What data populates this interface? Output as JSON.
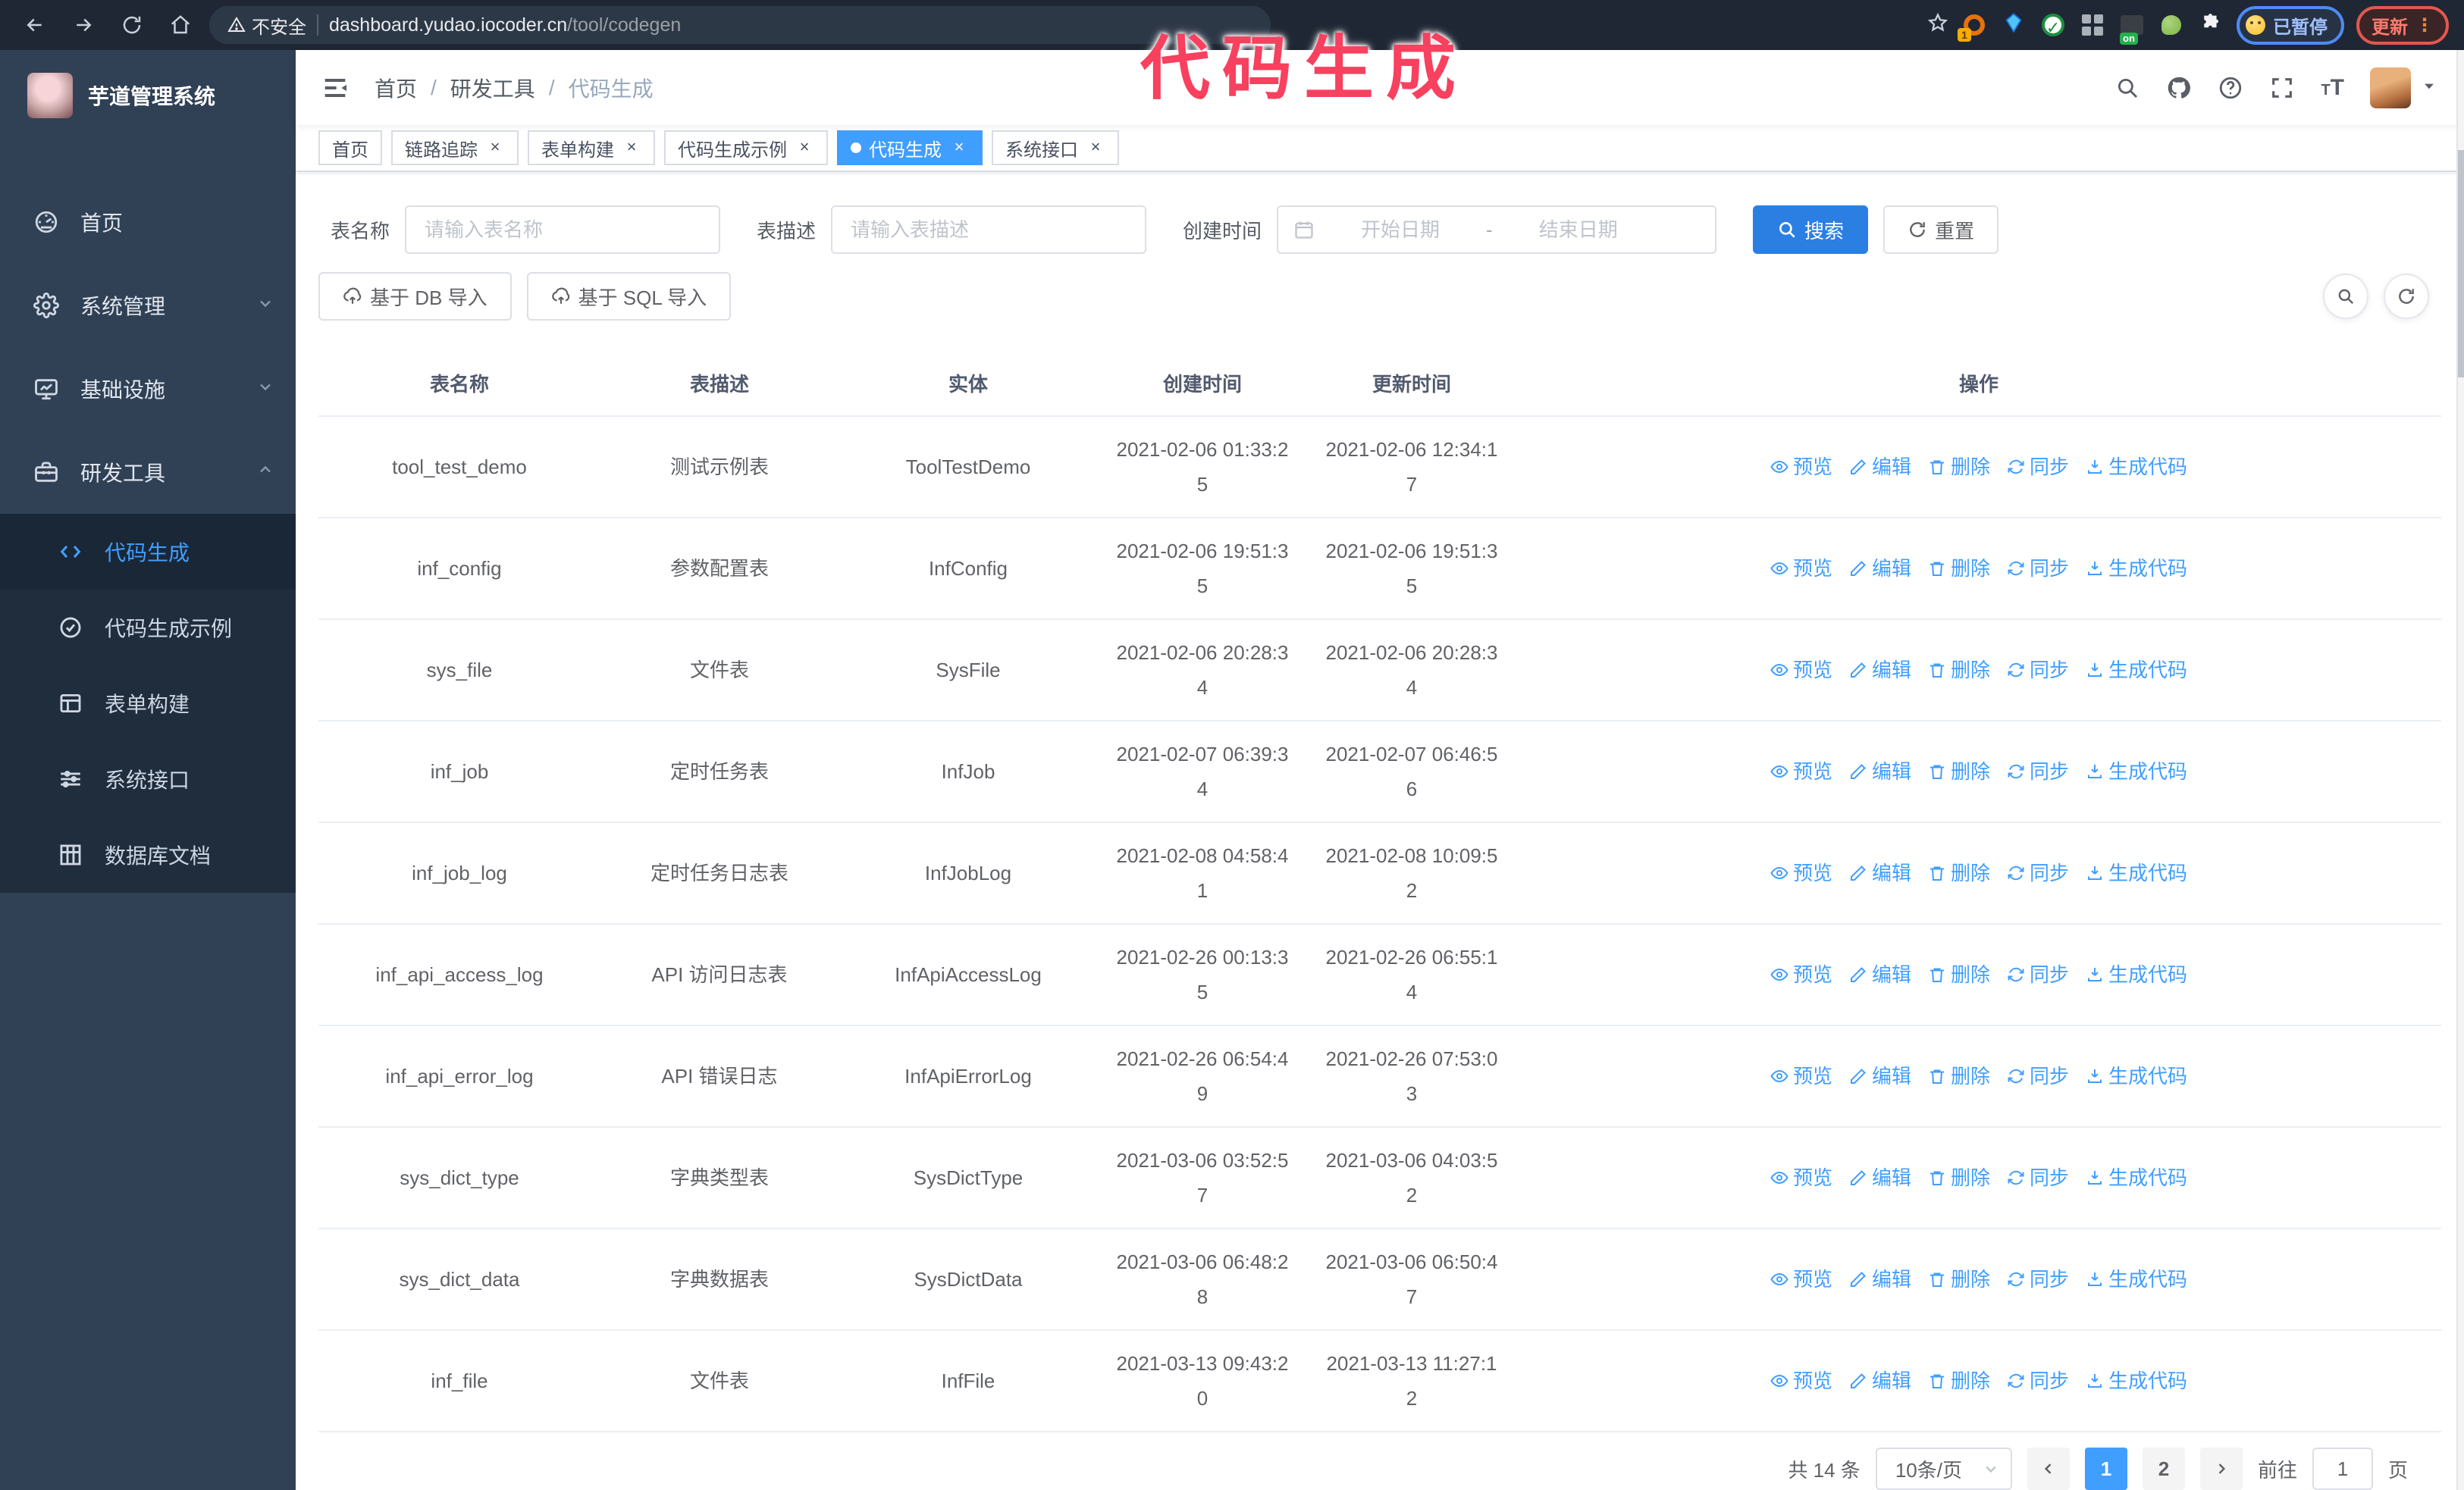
{
  "colors": {
    "accent": "#409eff",
    "sidebar_bg": "#304156",
    "submenu_bg": "#1f2d3d",
    "annotation": "#f8405f",
    "tag_active_bg": "#409eff"
  },
  "annotation": {
    "text": "代码生成"
  },
  "browser": {
    "nav_icons": [
      "back-icon",
      "forward-icon",
      "reload-icon",
      "home-icon"
    ],
    "security_label": "不安全",
    "url_domain": "dashboard.yudao.iocoder.cn",
    "url_path": "/tool/codegen",
    "bookmark_icon": "star-icon",
    "extension_icons": [
      "orange-ring-extension-icon",
      "blue-gem-extension-icon",
      "green-check-extension-icon",
      "grid-extension-icon",
      "dark-on-extension-icon",
      "green-leaf-extension-icon",
      "puzzle-extension-icon"
    ],
    "paused_badge": "已暂停",
    "update_button": "更新",
    "update_menu_dots": "⋮"
  },
  "sidebar": {
    "app_title": "芋道管理系统",
    "items": [
      {
        "label": "首页",
        "icon": "dashboard-icon",
        "expand": ""
      },
      {
        "label": "系统管理",
        "icon": "gear-icon",
        "expand": "down"
      },
      {
        "label": "基础设施",
        "icon": "monitor-icon",
        "expand": "down"
      },
      {
        "label": "研发工具",
        "icon": "toolbox-icon",
        "expand": "up"
      }
    ],
    "sub_items": [
      {
        "label": "代码生成",
        "icon": "code-icon",
        "active": true
      },
      {
        "label": "代码生成示例",
        "icon": "check-badge-icon",
        "active": false
      },
      {
        "label": "表单构建",
        "icon": "form-icon",
        "active": false
      },
      {
        "label": "系统接口",
        "icon": "sliders-icon",
        "active": false
      },
      {
        "label": "数据库文档",
        "icon": "database-doc-icon",
        "active": false
      }
    ]
  },
  "header": {
    "breadcrumb": [
      "首页",
      "研发工具",
      "代码生成"
    ],
    "separator": "/",
    "right_icons": [
      "search-icon",
      "github-icon",
      "help-icon",
      "fullscreen-icon",
      "font-size-icon"
    ]
  },
  "tabs": [
    {
      "label": "首页",
      "closable": false,
      "active": false
    },
    {
      "label": "链路追踪",
      "closable": true,
      "active": false
    },
    {
      "label": "表单构建",
      "closable": true,
      "active": false
    },
    {
      "label": "代码生成示例",
      "closable": true,
      "active": false
    },
    {
      "label": "代码生成",
      "closable": true,
      "active": true
    },
    {
      "label": "系统接口",
      "closable": true,
      "active": false
    }
  ],
  "search_form": {
    "table_name_label": "表名称",
    "table_name_placeholder": "请输入表名称",
    "table_desc_label": "表描述",
    "table_desc_placeholder": "请输入表描述",
    "create_time_label": "创建时间",
    "start_placeholder": "开始日期",
    "range_separator": "-",
    "end_placeholder": "结束日期",
    "search_label": "搜索",
    "reset_label": "重置"
  },
  "toolbar": {
    "import_db_label": "基于 DB 导入",
    "import_sql_label": "基于 SQL 导入",
    "right_icons": [
      "search-icon",
      "refresh-icon"
    ]
  },
  "table": {
    "columns": [
      "表名称",
      "表描述",
      "实体",
      "创建时间",
      "更新时间",
      "操作"
    ],
    "actions": [
      {
        "name": "preview",
        "label": "预览",
        "icon": "eye-icon"
      },
      {
        "name": "edit",
        "label": "编辑",
        "icon": "pencil-icon"
      },
      {
        "name": "delete",
        "label": "删除",
        "icon": "trash-icon"
      },
      {
        "name": "sync",
        "label": "同步",
        "icon": "sync-icon"
      },
      {
        "name": "generate",
        "label": "生成代码",
        "icon": "download-icon"
      }
    ],
    "rows": [
      {
        "name": "tool_test_demo",
        "desc": "测试示例表",
        "entity": "ToolTestDemo",
        "created": "2021-02-06 01:33:25",
        "updated": "2021-02-06 12:34:17"
      },
      {
        "name": "inf_config",
        "desc": "参数配置表",
        "entity": "InfConfig",
        "created": "2021-02-06 19:51:35",
        "updated": "2021-02-06 19:51:35"
      },
      {
        "name": "sys_file",
        "desc": "文件表",
        "entity": "SysFile",
        "created": "2021-02-06 20:28:34",
        "updated": "2021-02-06 20:28:34"
      },
      {
        "name": "inf_job",
        "desc": "定时任务表",
        "entity": "InfJob",
        "created": "2021-02-07 06:39:34",
        "updated": "2021-02-07 06:46:56"
      },
      {
        "name": "inf_job_log",
        "desc": "定时任务日志表",
        "entity": "InfJobLog",
        "created": "2021-02-08 04:58:41",
        "updated": "2021-02-08 10:09:52"
      },
      {
        "name": "inf_api_access_log",
        "desc": "API 访问日志表",
        "entity": "InfApiAccessLog",
        "created": "2021-02-26 00:13:35",
        "updated": "2021-02-26 06:55:14"
      },
      {
        "name": "inf_api_error_log",
        "desc": "API 错误日志",
        "entity": "InfApiErrorLog",
        "created": "2021-02-26 06:54:49",
        "updated": "2021-02-26 07:53:03"
      },
      {
        "name": "sys_dict_type",
        "desc": "字典类型表",
        "entity": "SysDictType",
        "created": "2021-03-06 03:52:57",
        "updated": "2021-03-06 04:03:52"
      },
      {
        "name": "sys_dict_data",
        "desc": "字典数据表",
        "entity": "SysDictData",
        "created": "2021-03-06 06:48:28",
        "updated": "2021-03-06 06:50:47"
      },
      {
        "name": "inf_file",
        "desc": "文件表",
        "entity": "InfFile",
        "created": "2021-03-13 09:43:20",
        "updated": "2021-03-13 11:27:12"
      }
    ]
  },
  "pagination": {
    "total_label": "共 14 条",
    "page_size_label": "10条/页",
    "pages": [
      "1",
      "2"
    ],
    "active_page": "1",
    "goto_label": "前往",
    "goto_value": "1",
    "page_unit_label": "页"
  }
}
